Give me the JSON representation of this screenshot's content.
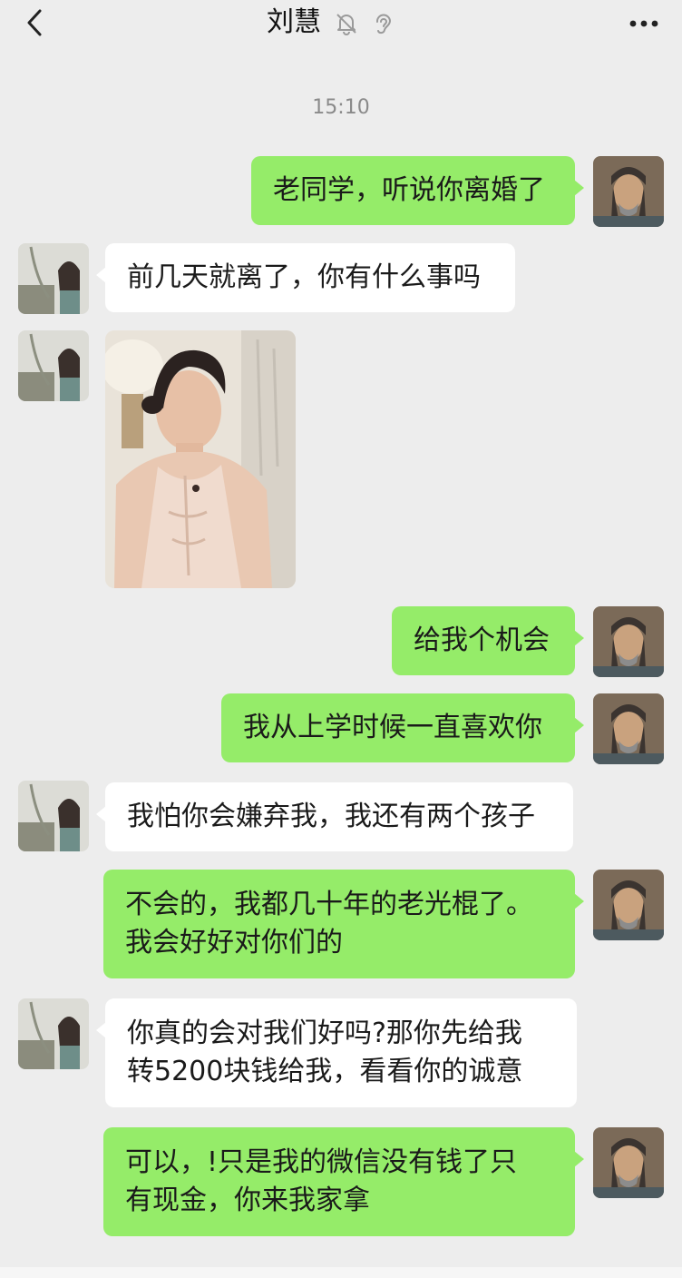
{
  "header": {
    "title": "刘慧",
    "back_icon": "chevron-left-icon",
    "mute_icon": "bell-off-icon",
    "earpiece_icon": "ear-icon",
    "more_icon": "more-dots-icon"
  },
  "timestamp": "15:10",
  "messages": [
    {
      "sender": "me",
      "lines": [
        "老同学，听说你离婚了"
      ]
    },
    {
      "sender": "her",
      "lines": [
        "前几天就离了，你有什么事吗"
      ]
    },
    {
      "sender": "her",
      "type": "image"
    },
    {
      "sender": "me",
      "lines": [
        "给我个机会"
      ]
    },
    {
      "sender": "me",
      "lines": [
        "我从上学时候一直喜欢你"
      ]
    },
    {
      "sender": "her",
      "lines": [
        "我怕你会嫌弃我，我还有两个孩子"
      ]
    },
    {
      "sender": "me",
      "lines": [
        "不会的，我都几十年的老光棍了。",
        "我会好好对你们的"
      ]
    },
    {
      "sender": "her",
      "lines": [
        "你真的会对我们好吗?那你先给我",
        "转5200块钱给我，看看你的诚意"
      ]
    },
    {
      "sender": "me",
      "lines": [
        "可以，!只是我的微信没有钱了只",
        "有现金，你来我家拿"
      ]
    }
  ],
  "colors": {
    "background": "#ededed",
    "my_bubble": "#95ec69",
    "her_bubble": "#ffffff"
  }
}
